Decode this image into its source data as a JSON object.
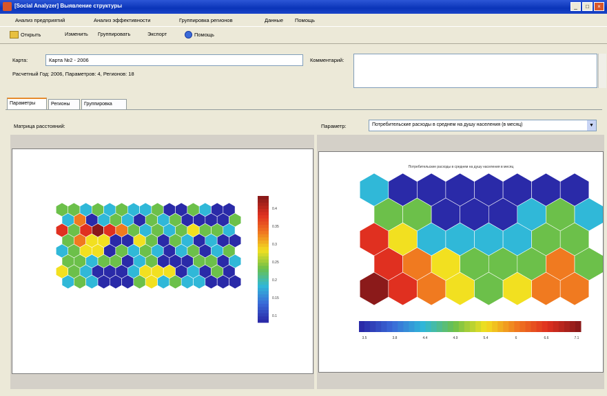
{
  "window": {
    "title": "[Social Analyzer] Выявление структуры",
    "controls": [
      "_",
      "□",
      "×"
    ]
  },
  "menu": [
    "Анализ предприятий",
    "Анализ эффективности",
    "Группировка регионов",
    "Данные",
    "Помощь"
  ],
  "toolbar": {
    "open": "Открыть",
    "edit": "Изменить",
    "group": "Группировать",
    "export": "Экспорт",
    "help": "Помощь"
  },
  "map": {
    "label": "Карта:",
    "value": "Карта №2 - 2006",
    "info": "Расчетный Год: 2006, Параметров: 4, Регионов: 18"
  },
  "comments": {
    "label": "Комментарий:",
    "value": ""
  },
  "tabs": [
    {
      "label": "Параметры",
      "active": true
    },
    {
      "label": "Регионы",
      "active": false
    },
    {
      "label": "Группировка",
      "active": false
    }
  ],
  "left_panel": {
    "label": "Матрица расстояний:"
  },
  "right_panel": {
    "param_label": "Параметр:",
    "param_value": "Потребительские расходы в среднем на душу населения (в месяц)",
    "chart_title": "Потребительские расходы в среднем на душу населения в месяц"
  },
  "left_colorbar_ticks": [
    "0.4",
    "0.35",
    "0.3",
    "0.25",
    "0.2",
    "0.15",
    "0.1"
  ],
  "right_colorbar_ticks": [
    "3.5",
    "3.8",
    "4.4",
    "4.9",
    "5.4",
    "6",
    "6.6",
    "7.1"
  ],
  "colors": {
    "titlebar": "#0a34b8",
    "tab_accent": "#e68b2c",
    "window_bg": "#ece9d8"
  },
  "left_grid_rows": [
    "ggcgcgccgbbgcbb",
    "cobcgcbgcgbbbbg",
    "rgrDrogcgcgyggc",
    "goyybbygbgcbcbb",
    "cgyybgcgcbcgbcg",
    "ggcggbcgbbbggbc",
    "ygcbbbcyyybcbgb",
    "cgcbbbgycgccbbb"
  ],
  "right_grid_rows": [
    "cbbbbbbb",
    "ggbbbcgc",
    "ryccccgg",
    "roygggog",
    "Droygyoo"
  ]
}
